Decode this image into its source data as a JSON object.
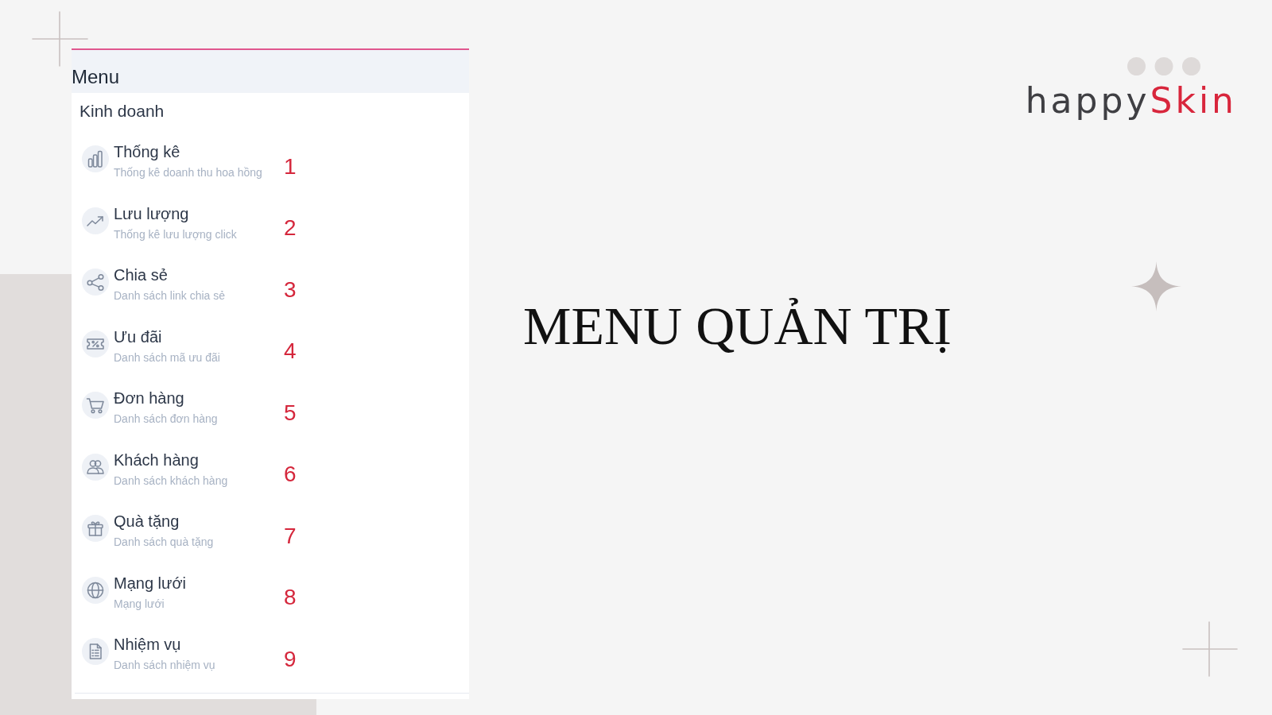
{
  "menu_panel": {
    "title": "Menu",
    "section": {
      "title": "Kinh doanh",
      "items": [
        {
          "label": "Thống kê",
          "description": "Thống kê doanh thu hoa hồng",
          "annotation": "1"
        },
        {
          "label": "Lưu lượng",
          "description": "Thống kê lưu lượng click",
          "annotation": "2"
        },
        {
          "label": "Chia sẻ",
          "description": "Danh sách link chia sẻ",
          "annotation": "3"
        },
        {
          "label": "Ưu đãi",
          "description": "Danh sách mã ưu đãi",
          "annotation": "4"
        },
        {
          "label": "Đơn hàng",
          "description": "Danh sách đơn hàng",
          "annotation": "5"
        },
        {
          "label": "Khách hàng",
          "description": "Danh sách khách hàng",
          "annotation": "6"
        },
        {
          "label": "Quà tặng",
          "description": "Danh sách quà tặng",
          "annotation": "7"
        },
        {
          "label": "Mạng lưới",
          "description": "Mạng lưới",
          "annotation": "8"
        },
        {
          "label": "Nhiệm vụ",
          "description": "Danh sách nhiệm vụ",
          "annotation": "9"
        }
      ]
    }
  },
  "logo": {
    "parts": [
      "happy",
      "Skin"
    ]
  },
  "headline": "MENU QUẢN TRỊ"
}
